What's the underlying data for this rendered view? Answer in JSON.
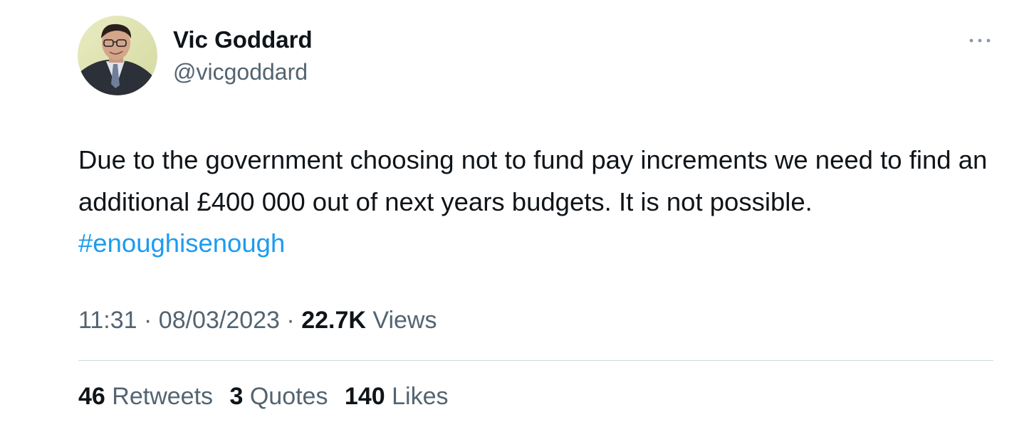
{
  "author": {
    "display_name": "Vic Goddard",
    "handle": "@vicgoddard",
    "avatar_icon": "profile-photo-avatar"
  },
  "tweet": {
    "text": "Due to the government choosing not to fund pay increments we need to find an additional £400 000 out of next years budgets. It is not possible. ",
    "hashtag": "#enoughisenough",
    "time": "11:31",
    "separator": "·",
    "date": "08/03/2023",
    "views_count": "22.7K",
    "views_label": "Views"
  },
  "stats": {
    "retweets_count": "46",
    "retweets_label": "Retweets",
    "quotes_count": "3",
    "quotes_label": "Quotes",
    "likes_count": "140",
    "likes_label": "Likes"
  },
  "colors": {
    "link": "#1d9bf0",
    "secondary_text": "#536471",
    "primary_text": "#0f1419",
    "divider": "#cfd9de"
  },
  "icons": {
    "more": "more-options-icon"
  }
}
